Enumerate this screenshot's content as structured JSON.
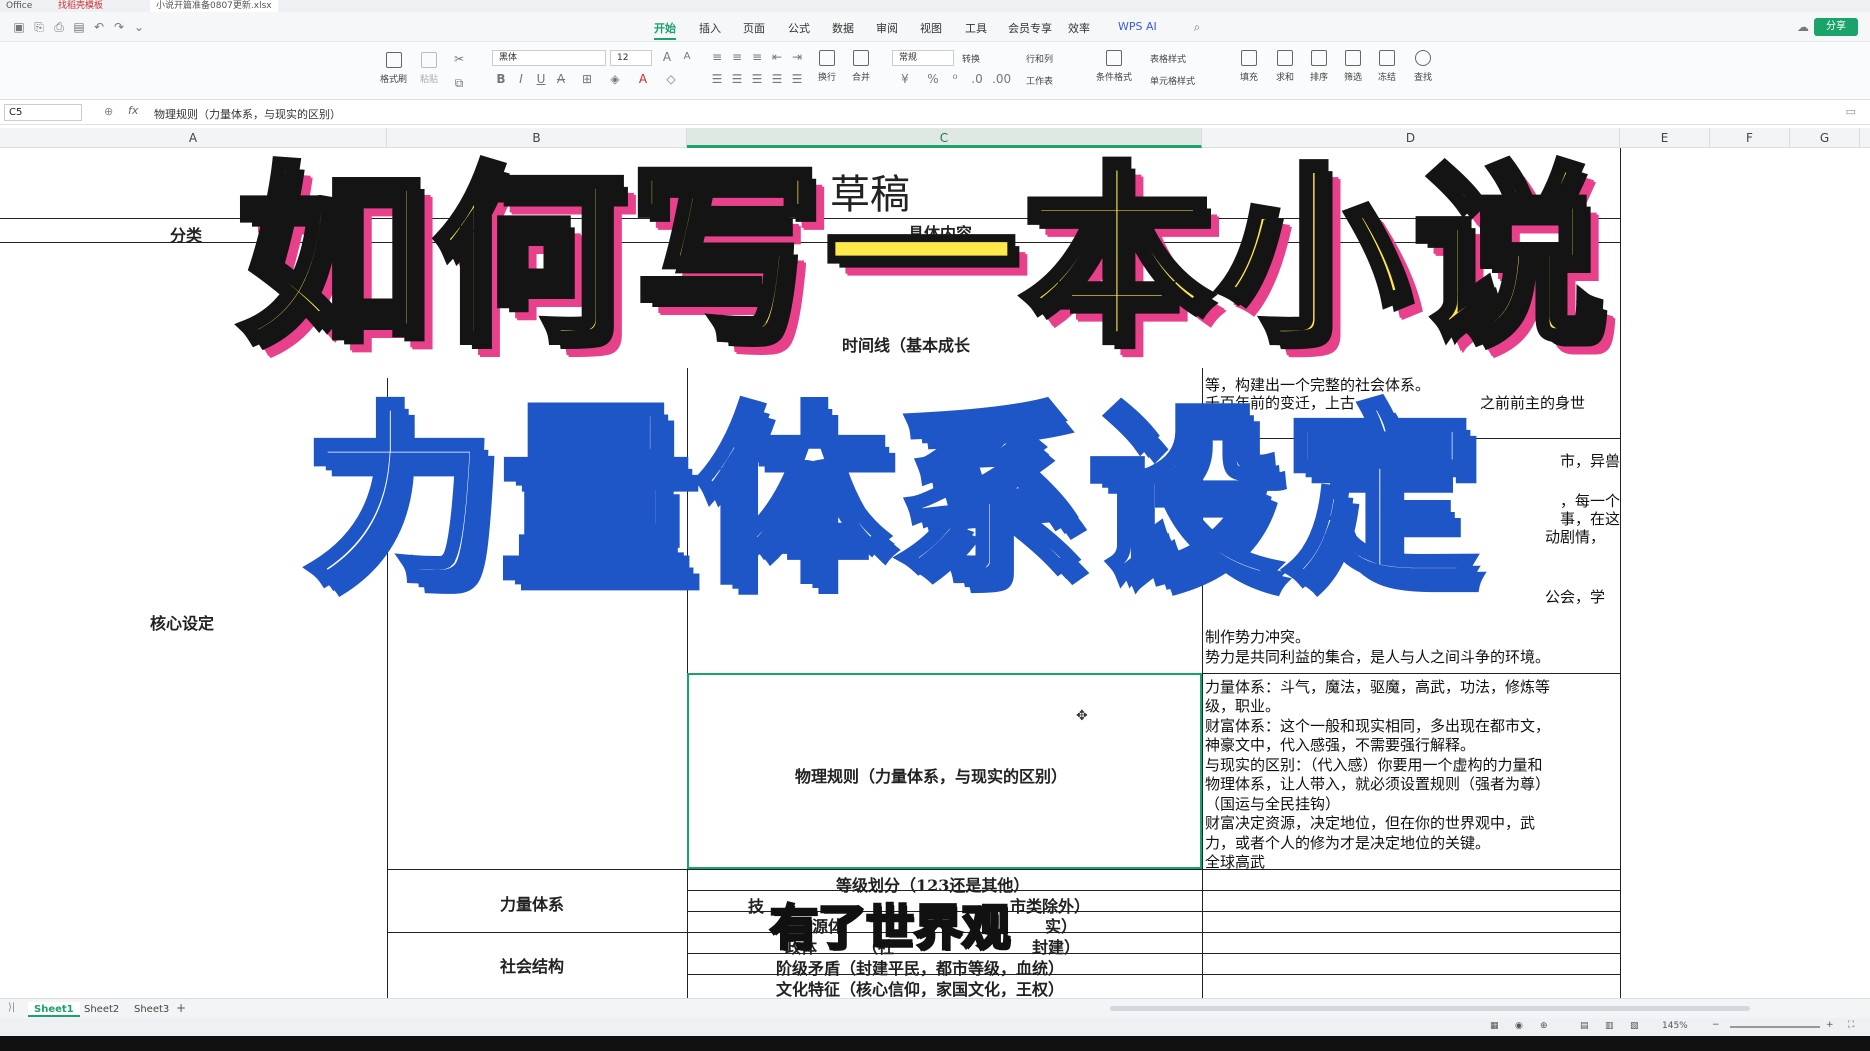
{
  "titlebar": {
    "app": "Office",
    "tab1": "找稻壳模板",
    "tab2": "小说开篇准备0807更新.xlsx"
  },
  "menu": {
    "tabs": [
      "开始",
      "插入",
      "页面",
      "公式",
      "数据",
      "审阅",
      "视图",
      "工具",
      "会员专享",
      "效率",
      "WPS AI"
    ],
    "share": "分享"
  },
  "ribbon": {
    "format_painter": "格式刷",
    "paste": "粘贴",
    "font_name": "黑体",
    "font_size": "12",
    "wrap": "换行",
    "merge": "合并",
    "number_format": "常规",
    "convert": "转换",
    "row_col": "行和列",
    "worksheet": "工作表",
    "cond_format": "条件格式",
    "table_style": "表格样式",
    "cell_style": "单元格样式",
    "fill": "填充",
    "sum": "求和",
    "sort": "排序",
    "filter": "筛选",
    "freeze": "冻结",
    "find": "查找"
  },
  "formula_bar": {
    "cell_ref": "C5",
    "fx": "fx",
    "content": "物理规则（力量体系，与现实的区别）"
  },
  "columns": [
    "A",
    "B",
    "C",
    "D",
    "E",
    "F",
    "G"
  ],
  "sheet": {
    "title_partial": "草稿",
    "header_category": "分类",
    "header_content": "具体内容",
    "timeline": "时间线（基本成长",
    "core_setting": "核心设定",
    "physical_rules": "物理规则（力量体系，与现实的区别）",
    "power_system": "力量体系",
    "social_structure": "社会结构",
    "c_rows": [
      "等级划分（123还是其他）",
      "技",
      "市类除外）",
      "源体",
      "实）",
      "政体",
      "（社",
      "封建）",
      "阶级矛盾（封建平民，都市等级，血统）",
      "文化特征（核心信仰，家国文化，王权）"
    ],
    "d_upper": [
      "等，构建出一个完整的社会体系。",
      "千百年前的变迁，上古",
      "之前前主的身世",
      "市，异兽",
      "，每一个",
      "事，在这",
      "动剧情，",
      "公会，学",
      "制作势力冲突。",
      "势力是共同利益的集合，是人与人之间斗争的环境。"
    ],
    "d_lines": [
      "力量体系：斗气，魔法，驱魔，高武，功法，修炼等",
      "级，职业。",
      "财富体系：这个一般和现实相同，多出现在都市文，",
      "神豪文中，代入感强，不需要强行解释。",
      "与现实的区别：（代入感）你要用一个虚构的力量和",
      "物理体系，让人带入，就必须设置规则（强者为尊）",
      "（国运与全民挂钩）",
      "财富决定资源，决定地位，但在你的世界观中，武",
      "力，或者个人的修为才是决定地位的关键。",
      "全球高武"
    ]
  },
  "sheets": [
    "Sheet1",
    "Sheet2",
    "Sheet3"
  ],
  "status": {
    "zoom": "145%"
  },
  "overlay": {
    "title_line1": "如何写一本小说",
    "title_line2": "力量体系设定",
    "subtitle": "有了世界观"
  },
  "colors": {
    "accent": "#1aa36b",
    "title1_fill": "#ffe94a",
    "title1_shadow": "#e8408a",
    "title2_stroke": "#1f56c7"
  }
}
